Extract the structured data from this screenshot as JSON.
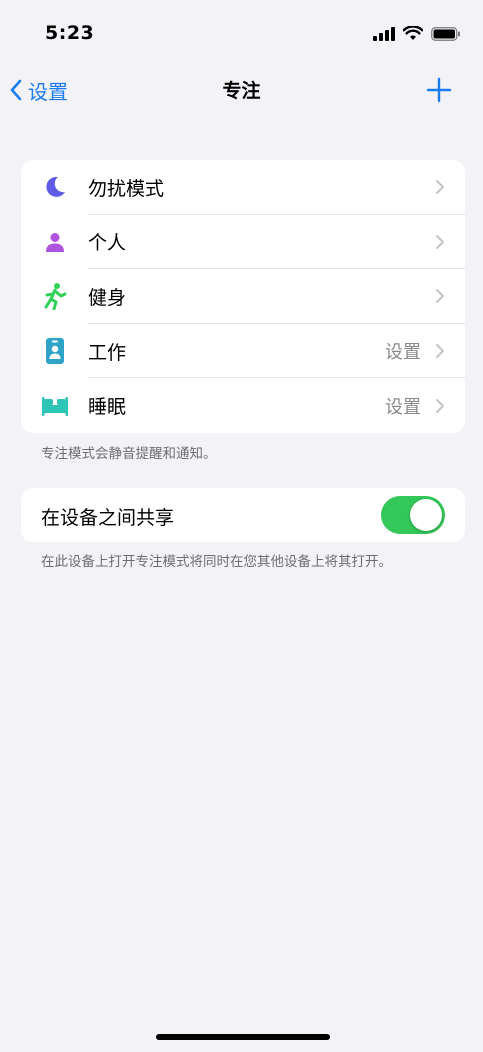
{
  "status_bar": {
    "time": "5:23"
  },
  "nav": {
    "back_label": "设置",
    "title": "专注"
  },
  "focus_modes": [
    {
      "label": "勿扰模式",
      "value": "",
      "icon": "moon-icon",
      "color": "#5e5ce6"
    },
    {
      "label": "个人",
      "value": "",
      "icon": "person-icon",
      "color": "#af52de"
    },
    {
      "label": "健身",
      "value": "",
      "icon": "running-icon",
      "color": "#30d158"
    },
    {
      "label": "工作",
      "value": "设置",
      "icon": "id-badge-icon",
      "color": "#30a3c9"
    },
    {
      "label": "睡眠",
      "value": "设置",
      "icon": "bed-icon",
      "color": "#2ec4b6"
    }
  ],
  "focus_footnote": "专注模式会静音提醒和通知。",
  "share": {
    "label": "在设备之间共享",
    "enabled": true,
    "footnote": "在此设备上打开专注模式将同时在您其他设备上将其打开。"
  },
  "colors": {
    "accent": "#1a7cf5",
    "toggle_on": "#34c759",
    "background": "#f2f2f7"
  }
}
